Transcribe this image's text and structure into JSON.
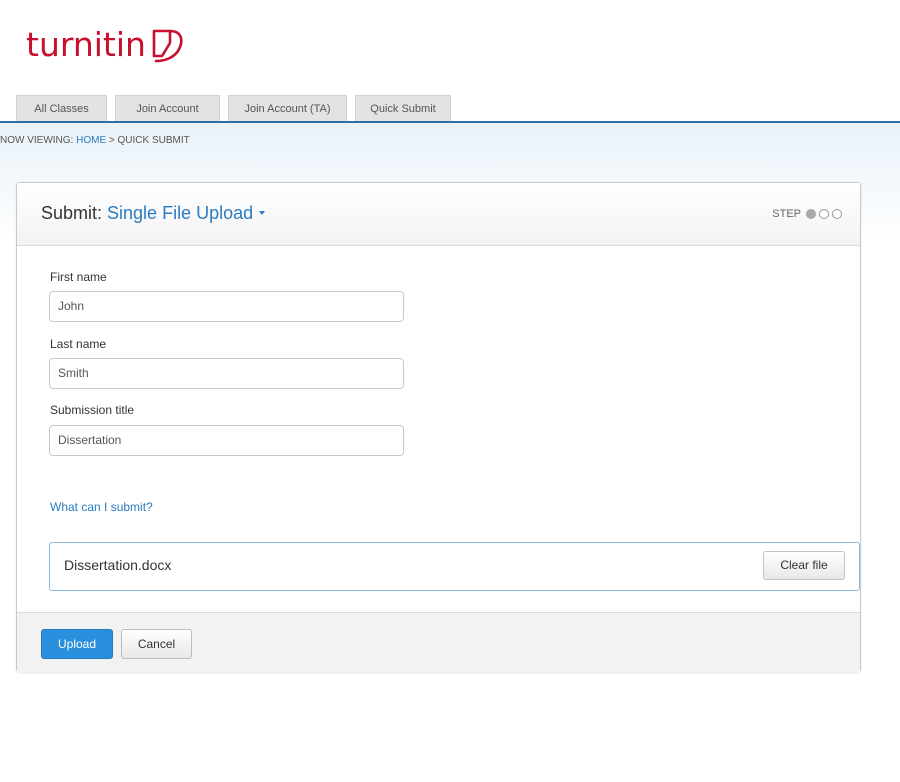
{
  "brand": {
    "logo_text": "turnitin",
    "logo_color": "#c8102e"
  },
  "tabs": [
    {
      "label": "All Classes"
    },
    {
      "label": "Join Account"
    },
    {
      "label": "Join Account (TA)"
    },
    {
      "label": "Quick Submit"
    }
  ],
  "breadcrumb": {
    "prefix": "NOW VIEWING: ",
    "home": "HOME",
    "separator": " > ",
    "current": "QUICK SUBMIT"
  },
  "panel": {
    "title_prefix": "Submit: ",
    "mode": "Single File Upload",
    "step_label": "STEP",
    "steps_total": 3,
    "step_current": 1
  },
  "form": {
    "first_name_label": "First name",
    "first_name_value": "John",
    "last_name_label": "Last name",
    "last_name_value": "Smith",
    "title_label": "Submission title",
    "title_value": "Dissertation",
    "help_link": "What can I submit?"
  },
  "file": {
    "name": "Dissertation.docx",
    "clear_label": "Clear file"
  },
  "footer": {
    "upload_label": "Upload",
    "cancel_label": "Cancel"
  },
  "colors": {
    "accent": "#2a7bc0",
    "primary_button": "#2a90dd",
    "nav_line": "#2f6f9f"
  },
  "icons": {
    "logo_mark": "turnitin-logo-mark",
    "mode_dropdown": "caret-down-icon",
    "step_dots": "step-indicator-icon"
  }
}
